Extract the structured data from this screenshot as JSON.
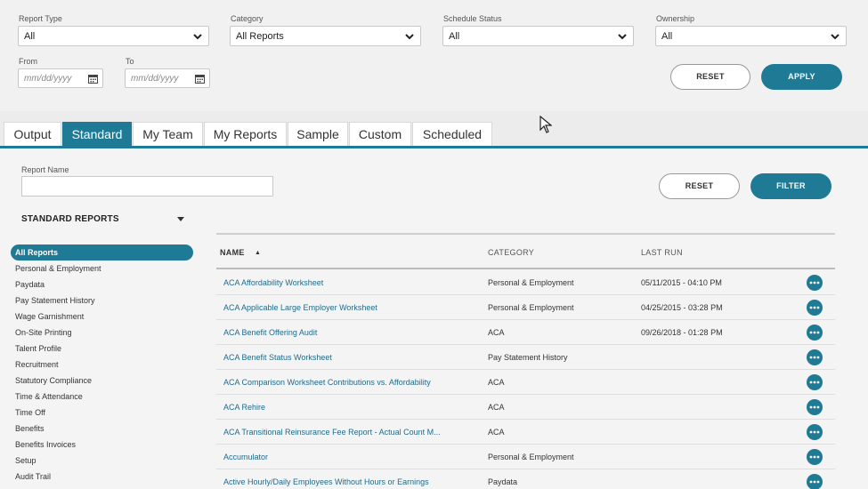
{
  "filters": {
    "report_type": {
      "label": "Report Type",
      "value": "All"
    },
    "category": {
      "label": "Category",
      "value": "All Reports"
    },
    "schedule_status": {
      "label": "Schedule Status",
      "value": "All"
    },
    "ownership": {
      "label": "Ownership",
      "value": "All"
    },
    "from": {
      "label": "From",
      "placeholder": "mm/dd/yyyy"
    },
    "to": {
      "label": "To",
      "placeholder": "mm/dd/yyyy"
    },
    "reset_label": "RESET",
    "apply_label": "APPLY"
  },
  "tabs": [
    "Output",
    "Standard",
    "My Team",
    "My Reports",
    "Sample",
    "Custom",
    "Scheduled"
  ],
  "active_tab": "Standard",
  "report_name": {
    "label": "Report Name",
    "value": ""
  },
  "content_buttons": {
    "reset_label": "RESET",
    "filter_label": "FILTER"
  },
  "section_title": "STANDARD REPORTS",
  "sidebar_items": [
    "All Reports",
    "Personal & Employment",
    "Paydata",
    "Pay Statement History",
    "Wage Garnishment",
    "On-Site Printing",
    "Talent Profile",
    "Recruitment",
    "Statutory Compliance",
    "Time & Attendance",
    "Time Off",
    "Benefits",
    "Benefits Invoices",
    "Setup",
    "Audit Trail"
  ],
  "table": {
    "headers": {
      "name": "NAME",
      "category": "CATEGORY",
      "last_run": "LAST RUN"
    },
    "sort_indicator": "▲",
    "rows": [
      {
        "name": "ACA Affordability Worksheet",
        "category": "Personal & Employment",
        "last_run": "05/11/2015 - 04:10 PM"
      },
      {
        "name": "ACA Applicable Large Employer Worksheet",
        "category": "Personal & Employment",
        "last_run": "04/25/2015 - 03:28 PM"
      },
      {
        "name": "ACA Benefit Offering Audit",
        "category": "ACA",
        "last_run": "09/26/2018 - 01:28 PM"
      },
      {
        "name": "ACA Benefit Status Worksheet",
        "category": "Pay Statement History",
        "last_run": ""
      },
      {
        "name": "ACA Comparison Worksheet Contributions vs. Affordability",
        "category": "ACA",
        "last_run": ""
      },
      {
        "name": "ACA Rehire",
        "category": "ACA",
        "last_run": ""
      },
      {
        "name": "ACA Transitional Reinsurance Fee Report - Actual Count M...",
        "category": "ACA",
        "last_run": ""
      },
      {
        "name": "Accumulator",
        "category": "Personal & Employment",
        "last_run": ""
      },
      {
        "name": "Active Hourly/Daily Employees Without Hours or Earnings",
        "category": "Paydata",
        "last_run": ""
      }
    ]
  },
  "colors": {
    "accent": "#1f7a96"
  },
  "icons": {
    "dropdown": "chevron-down-icon",
    "calendar": "calendar-icon",
    "row_action": "more-options-icon"
  }
}
